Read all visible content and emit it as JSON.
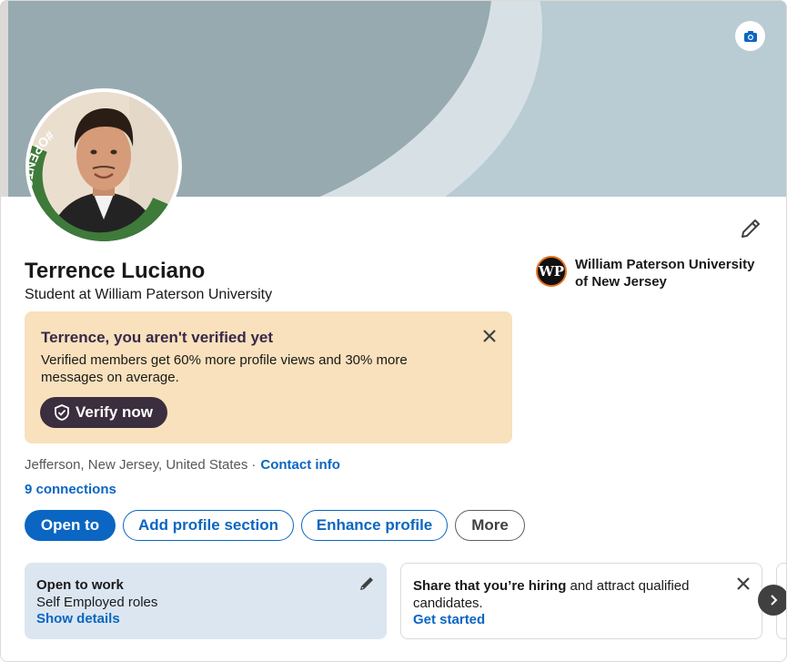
{
  "profile": {
    "name": "Terrence Luciano",
    "headline": "Student at William Paterson University",
    "avatar_badge": "#OPENTOWORK",
    "location": "Jefferson, New Jersey, United States",
    "separator": "·",
    "contact_info_label": "Contact info",
    "connections_label": "9 connections"
  },
  "education": {
    "school_name": "William Paterson University of New Jersey",
    "logo_text": "WP"
  },
  "verify_banner": {
    "title": "Terrence, you aren't verified yet",
    "body": "Verified members get 60% more profile views and 30% more messages on average.",
    "button_label": "Verify now"
  },
  "actions": {
    "open_to": "Open to",
    "add_section": "Add profile section",
    "enhance": "Enhance profile",
    "more": "More"
  },
  "open_to_work_card": {
    "title": "Open to work",
    "subtitle": "Self Employed roles",
    "link": "Show details"
  },
  "hiring_card": {
    "bold_text": "Share that you’re hiring",
    "text": " and attract qualified candidates.",
    "link": "Get started"
  },
  "icons": {
    "camera": "camera-icon",
    "edit": "pencil-icon",
    "close": "close-icon",
    "shield": "shield-check-icon",
    "next": "chevron-right-icon"
  },
  "colors": {
    "brand_blue": "#0a66c2",
    "open_to_work_green": "#3e7a3a",
    "verify_bg": "#f8e1bc",
    "verify_button": "#3b2e3e"
  }
}
